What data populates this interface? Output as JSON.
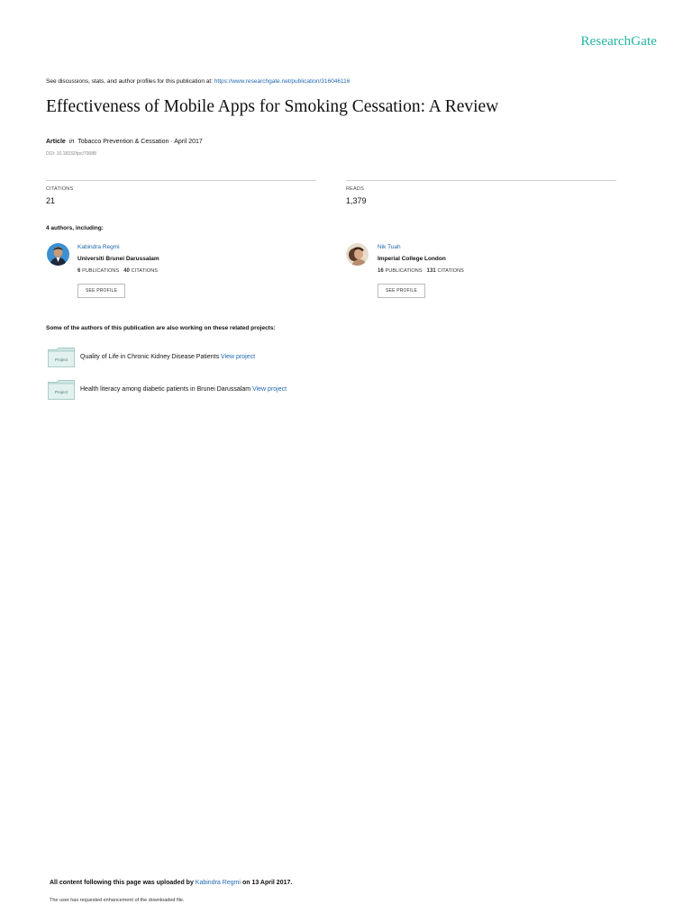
{
  "header": {
    "brand": "ResearchGate",
    "discussion_prefix": "See discussions, stats, and author profiles for this publication at: ",
    "publication_url": "https://www.researchgate.net/publication/316046116"
  },
  "publication": {
    "title": "Effectiveness of Mobile Apps for Smoking Cessation: A Review",
    "type": "Article",
    "in_label": "in",
    "journal_date": "Tobacco Prevention & Cessation · April 2017",
    "doi": "DOI: 10.18332/tpc/70088"
  },
  "stats": {
    "citations_label": "CITATIONS",
    "citations_value": "21",
    "reads_label": "READS",
    "reads_value": "1,379"
  },
  "authors_heading": "4 authors, including:",
  "authors": [
    {
      "name": "Kabindra Regmi",
      "institution": "Universiti Brunei Darussalam",
      "publications": "6",
      "publications_label": "PUBLICATIONS",
      "citations": "40",
      "citations_label": "CITATIONS",
      "button": "SEE PROFILE"
    },
    {
      "name": "Nik Tuah",
      "institution": "Imperial College London",
      "publications": "16",
      "publications_label": "PUBLICATIONS",
      "citations": "131",
      "citations_label": "CITATIONS",
      "button": "SEE PROFILE"
    }
  ],
  "projects_heading": "Some of the authors of this publication are also working on these related projects:",
  "projects": [
    {
      "icon_label": "Project",
      "title": "Quality of Life in Chronic Kidney Disease Patients",
      "link": "View project"
    },
    {
      "icon_label": "Project",
      "title": "Health literacy among diabetic patients in Brunei Darussalam",
      "link": "View project"
    }
  ],
  "footer": {
    "uploaded_prefix": "All content following this page was uploaded by",
    "uploader": "Kabindra Regmi",
    "uploaded_suffix": "on 13 April 2017.",
    "note": "The user has requested enhancement of the downloaded file."
  },
  "colors": {
    "brand": "#22b5a1",
    "link": "#1f67b1",
    "folder": "#cfe6e3"
  }
}
